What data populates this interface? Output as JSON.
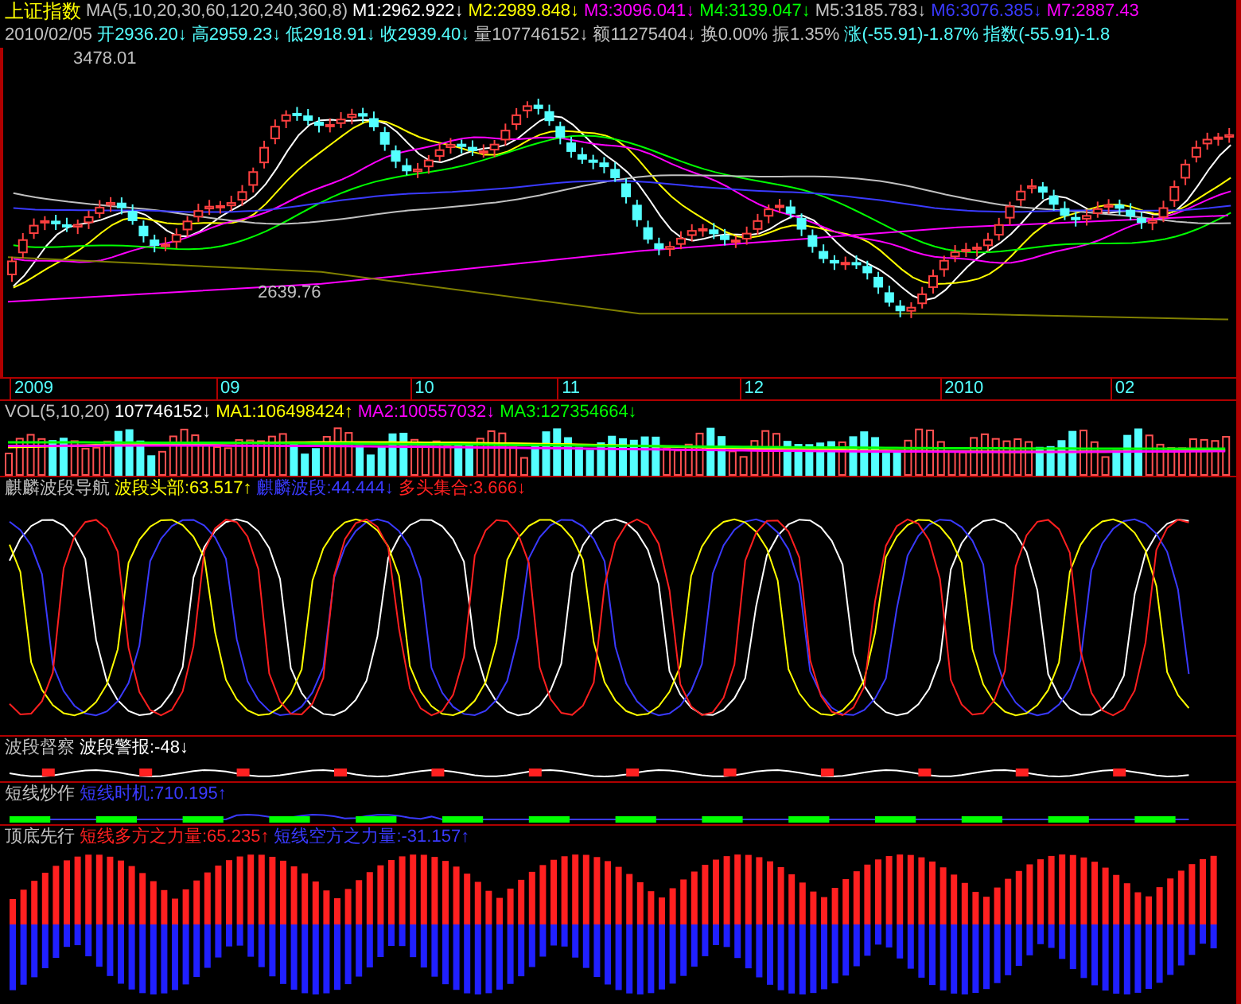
{
  "header": {
    "title": "上证指数",
    "ma_params": "MA(5,10,20,30,60,120,240,360,8)",
    "ma_values": [
      {
        "text": "M1:2962.922",
        "arrow": "↓",
        "color": "#ffffff"
      },
      {
        "text": "M2:2989.848",
        "arrow": "↓",
        "color": "#ffff00"
      },
      {
        "text": "M3:3096.041",
        "arrow": "↓",
        "color": "#ff00ff"
      },
      {
        "text": "M4:3139.047",
        "arrow": "↓",
        "color": "#00ff00"
      },
      {
        "text": "M5:3185.783",
        "arrow": "↓",
        "color": "#c0c0c0"
      },
      {
        "text": "M6:3076.385",
        "arrow": "↓",
        "color": "#3a3aff"
      },
      {
        "text": "M7:2887.43",
        "color": "#ff00ff"
      }
    ]
  },
  "quote": {
    "date": "2010/02/05",
    "fields": [
      {
        "text": "开2936.20",
        "arrow": "↓",
        "color": "#54ffff"
      },
      {
        "text": "高2959.23",
        "arrow": "↓",
        "color": "#54ffff"
      },
      {
        "text": "低2918.91",
        "arrow": "↓",
        "color": "#54ffff"
      },
      {
        "text": "收2939.40",
        "arrow": "↓",
        "color": "#54ffff"
      },
      {
        "text": "量107746152",
        "arrow": "↓",
        "color": "#c0c0c0"
      },
      {
        "text": "额11275404",
        "arrow": "↓",
        "color": "#c0c0c0"
      },
      {
        "text": "换0.00%",
        "color": "#c0c0c0"
      },
      {
        "text": "振1.35%",
        "color": "#c0c0c0"
      },
      {
        "text": "涨(-55.91)-1.87%",
        "color": "#54ffff"
      },
      {
        "text": "指数(-55.91)-1.8",
        "color": "#54ffff"
      }
    ]
  },
  "price_chart": {
    "high_label": "3478.01",
    "low_label": "2639.76"
  },
  "time_axis": [
    "2009",
    "09",
    "10",
    "11",
    "12",
    "2010",
    "02"
  ],
  "volume": {
    "title": "VOL(5,10,20)",
    "values": [
      {
        "text": "107746152",
        "arrow": "↓",
        "color": "#ffffff"
      },
      {
        "text": "MA1:106498424",
        "arrow": "↑",
        "color": "#ffff00"
      },
      {
        "text": "MA2:100557032",
        "arrow": "↓",
        "color": "#ff00ff"
      },
      {
        "text": "MA3:127354664",
        "arrow": "↓",
        "color": "#00ff00"
      }
    ]
  },
  "indicators": [
    {
      "kind": "waves",
      "title": "麒麟波段导航",
      "values": [
        {
          "text": "波段头部:63.517",
          "arrow": "↑",
          "color": "#ffff00"
        },
        {
          "text": "麒麟波段:44.444",
          "arrow": "↓",
          "color": "#3a3aff"
        },
        {
          "text": "多头集合:3.666",
          "arrow": "↓",
          "color": "#ff2020"
        }
      ]
    },
    {
      "kind": "alert",
      "title": "波段督察",
      "values": [
        {
          "text": "波段警报:-48",
          "arrow": "↓",
          "color": "#ffffff"
        }
      ]
    },
    {
      "kind": "timing",
      "title": "短线炒作",
      "values": [
        {
          "text": "短线时机:710.195",
          "arrow": "↑",
          "color": "#3a3aff"
        }
      ]
    },
    {
      "kind": "force",
      "title": "顶底先行",
      "values": [
        {
          "text": "短线多方之力量:65.235",
          "arrow": "↑",
          "color": "#ff2020"
        },
        {
          "text": "短线空方之力量:-31.157",
          "arrow": "↑",
          "color": "#3a3aff"
        }
      ]
    }
  ]
}
